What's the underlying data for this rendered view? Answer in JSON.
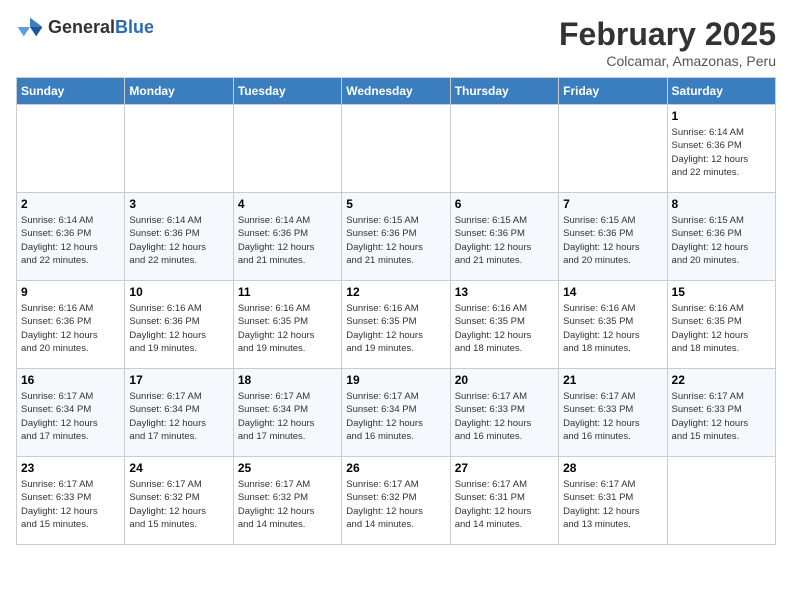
{
  "header": {
    "logo_general": "General",
    "logo_blue": "Blue",
    "title": "February 2025",
    "subtitle": "Colcamar, Amazonas, Peru"
  },
  "days_of_week": [
    "Sunday",
    "Monday",
    "Tuesday",
    "Wednesday",
    "Thursday",
    "Friday",
    "Saturday"
  ],
  "weeks": [
    [
      {
        "day": "",
        "info": ""
      },
      {
        "day": "",
        "info": ""
      },
      {
        "day": "",
        "info": ""
      },
      {
        "day": "",
        "info": ""
      },
      {
        "day": "",
        "info": ""
      },
      {
        "day": "",
        "info": ""
      },
      {
        "day": "1",
        "info": "Sunrise: 6:14 AM\nSunset: 6:36 PM\nDaylight: 12 hours\nand 22 minutes."
      }
    ],
    [
      {
        "day": "2",
        "info": "Sunrise: 6:14 AM\nSunset: 6:36 PM\nDaylight: 12 hours\nand 22 minutes."
      },
      {
        "day": "3",
        "info": "Sunrise: 6:14 AM\nSunset: 6:36 PM\nDaylight: 12 hours\nand 22 minutes."
      },
      {
        "day": "4",
        "info": "Sunrise: 6:14 AM\nSunset: 6:36 PM\nDaylight: 12 hours\nand 21 minutes."
      },
      {
        "day": "5",
        "info": "Sunrise: 6:15 AM\nSunset: 6:36 PM\nDaylight: 12 hours\nand 21 minutes."
      },
      {
        "day": "6",
        "info": "Sunrise: 6:15 AM\nSunset: 6:36 PM\nDaylight: 12 hours\nand 21 minutes."
      },
      {
        "day": "7",
        "info": "Sunrise: 6:15 AM\nSunset: 6:36 PM\nDaylight: 12 hours\nand 20 minutes."
      },
      {
        "day": "8",
        "info": "Sunrise: 6:15 AM\nSunset: 6:36 PM\nDaylight: 12 hours\nand 20 minutes."
      }
    ],
    [
      {
        "day": "9",
        "info": "Sunrise: 6:16 AM\nSunset: 6:36 PM\nDaylight: 12 hours\nand 20 minutes."
      },
      {
        "day": "10",
        "info": "Sunrise: 6:16 AM\nSunset: 6:36 PM\nDaylight: 12 hours\nand 19 minutes."
      },
      {
        "day": "11",
        "info": "Sunrise: 6:16 AM\nSunset: 6:35 PM\nDaylight: 12 hours\nand 19 minutes."
      },
      {
        "day": "12",
        "info": "Sunrise: 6:16 AM\nSunset: 6:35 PM\nDaylight: 12 hours\nand 19 minutes."
      },
      {
        "day": "13",
        "info": "Sunrise: 6:16 AM\nSunset: 6:35 PM\nDaylight: 12 hours\nand 18 minutes."
      },
      {
        "day": "14",
        "info": "Sunrise: 6:16 AM\nSunset: 6:35 PM\nDaylight: 12 hours\nand 18 minutes."
      },
      {
        "day": "15",
        "info": "Sunrise: 6:16 AM\nSunset: 6:35 PM\nDaylight: 12 hours\nand 18 minutes."
      }
    ],
    [
      {
        "day": "16",
        "info": "Sunrise: 6:17 AM\nSunset: 6:34 PM\nDaylight: 12 hours\nand 17 minutes."
      },
      {
        "day": "17",
        "info": "Sunrise: 6:17 AM\nSunset: 6:34 PM\nDaylight: 12 hours\nand 17 minutes."
      },
      {
        "day": "18",
        "info": "Sunrise: 6:17 AM\nSunset: 6:34 PM\nDaylight: 12 hours\nand 17 minutes."
      },
      {
        "day": "19",
        "info": "Sunrise: 6:17 AM\nSunset: 6:34 PM\nDaylight: 12 hours\nand 16 minutes."
      },
      {
        "day": "20",
        "info": "Sunrise: 6:17 AM\nSunset: 6:33 PM\nDaylight: 12 hours\nand 16 minutes."
      },
      {
        "day": "21",
        "info": "Sunrise: 6:17 AM\nSunset: 6:33 PM\nDaylight: 12 hours\nand 16 minutes."
      },
      {
        "day": "22",
        "info": "Sunrise: 6:17 AM\nSunset: 6:33 PM\nDaylight: 12 hours\nand 15 minutes."
      }
    ],
    [
      {
        "day": "23",
        "info": "Sunrise: 6:17 AM\nSunset: 6:33 PM\nDaylight: 12 hours\nand 15 minutes."
      },
      {
        "day": "24",
        "info": "Sunrise: 6:17 AM\nSunset: 6:32 PM\nDaylight: 12 hours\nand 15 minutes."
      },
      {
        "day": "25",
        "info": "Sunrise: 6:17 AM\nSunset: 6:32 PM\nDaylight: 12 hours\nand 14 minutes."
      },
      {
        "day": "26",
        "info": "Sunrise: 6:17 AM\nSunset: 6:32 PM\nDaylight: 12 hours\nand 14 minutes."
      },
      {
        "day": "27",
        "info": "Sunrise: 6:17 AM\nSunset: 6:31 PM\nDaylight: 12 hours\nand 14 minutes."
      },
      {
        "day": "28",
        "info": "Sunrise: 6:17 AM\nSunset: 6:31 PM\nDaylight: 12 hours\nand 13 minutes."
      },
      {
        "day": "",
        "info": ""
      }
    ]
  ]
}
